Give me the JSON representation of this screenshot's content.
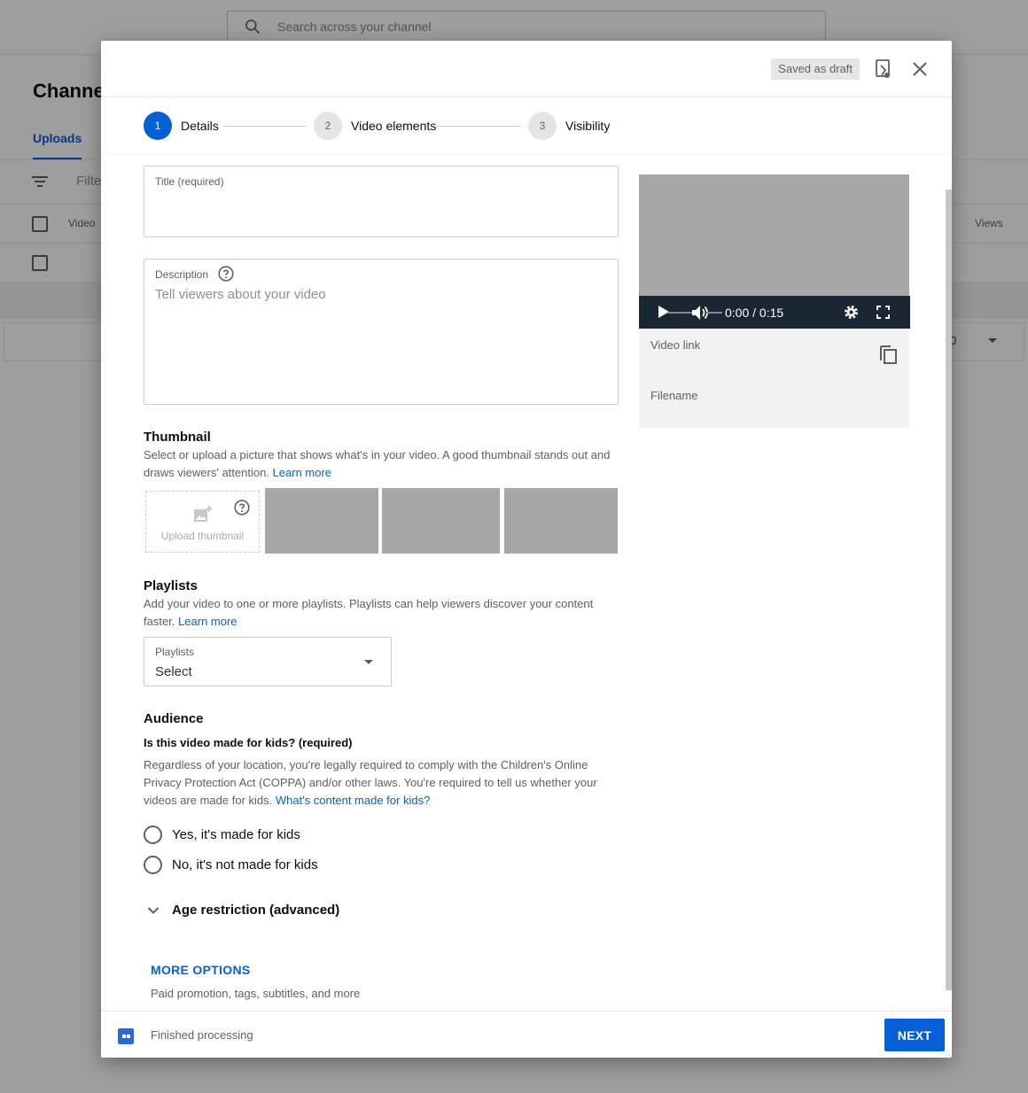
{
  "background": {
    "search_placeholder": "Search across your channel",
    "page_title": "Channe",
    "tab_uploads": "Uploads",
    "filter_text": "Filte",
    "col_video": "Video",
    "col_views": "Views",
    "pager_value": "0"
  },
  "dialog": {
    "draft_badge": "Saved as draft",
    "steps": [
      {
        "number": "1",
        "label": "Details"
      },
      {
        "number": "2",
        "label": "Video elements"
      },
      {
        "number": "3",
        "label": "Visibility"
      }
    ],
    "title_field": {
      "label": "Title (required)",
      "value": ""
    },
    "description_field": {
      "label": "Description",
      "placeholder": "Tell viewers about your video"
    },
    "thumbnail": {
      "heading": "Thumbnail",
      "description": "Select or upload a picture that shows what's in your video. A good thumbnail stands out and draws viewers' attention.",
      "learn_more": "Learn more",
      "upload_label": "Upload thumbnail"
    },
    "playlists": {
      "heading": "Playlists",
      "description": "Add your video to one or more playlists. Playlists can help viewers discover your content faster.",
      "learn_more": "Learn more",
      "select_label": "Playlists",
      "select_value": "Select"
    },
    "audience": {
      "heading": "Audience",
      "question": "Is this video made for kids? (required)",
      "description": "Regardless of your location, you're legally required to comply with the Children's Online Privacy Protection Act (COPPA) and/or other laws. You're required to tell us whether your videos are made for kids.",
      "link": "What's content made for kids?",
      "option_yes": "Yes, it's made for kids",
      "option_no": "No, it's not made for kids",
      "age_restriction": "Age restriction (advanced)"
    },
    "more_options": {
      "label": "MORE OPTIONS",
      "description": "Paid promotion, tags, subtitles, and more"
    },
    "preview": {
      "time": "0:00 / 0:15",
      "video_link_label": "Video link",
      "filename_label": "Filename"
    },
    "footer": {
      "status": "Finished processing",
      "next_label": "NEXT"
    }
  },
  "colors": {
    "accent": "#065fd4",
    "player_bar": "#1a2634",
    "placeholder_gray": "#a7a7a7"
  }
}
